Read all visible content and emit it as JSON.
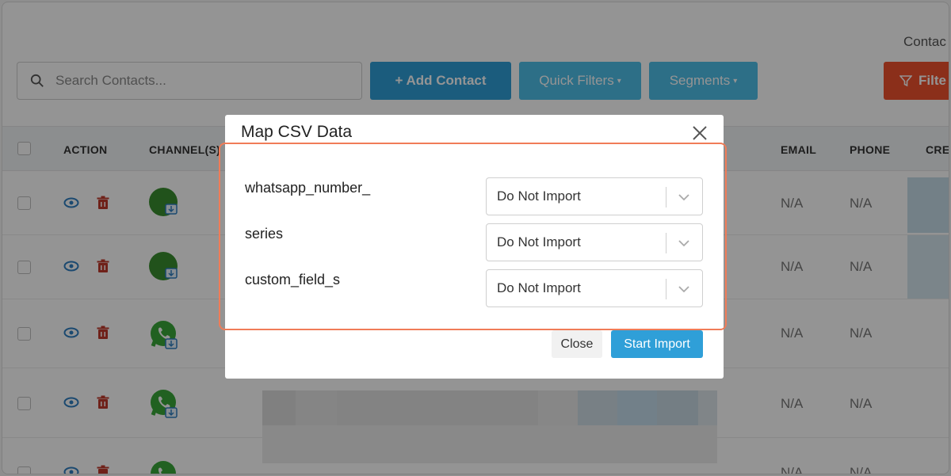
{
  "toolbar": {
    "contacts_title": "Contac",
    "search_placeholder": "Search Contacts...",
    "add_contact_label": "+ Add Contact",
    "quick_filters_label": "Quick Filters",
    "segments_label": "Segments",
    "filter_label": "Filte"
  },
  "table": {
    "headers": [
      "ACTION",
      "CHANNEL(S)",
      "EMAIL",
      "PHONE",
      "CREA"
    ],
    "rows": [
      {
        "email": "N/A",
        "phone": "N/A",
        "channel_icon": "channel-import-icon"
      },
      {
        "email": "N/A",
        "phone": "N/A",
        "channel_icon": "channel-import-icon"
      },
      {
        "email": "N/A",
        "phone": "N/A",
        "channel_icon": "whatsapp-icon"
      },
      {
        "email": "N/A",
        "phone": "N/A",
        "channel_icon": "whatsapp-icon"
      },
      {
        "email": "N/A",
        "phone": "N/A",
        "channel_icon": "whatsapp-icon"
      }
    ]
  },
  "modal": {
    "title": "Map CSV Data",
    "fields": [
      {
        "label": "whatsapp_number_",
        "value": "Do Not Import"
      },
      {
        "label": "series",
        "value": "Do Not Import"
      },
      {
        "label": "custom_field_s",
        "value": "Do Not Import"
      }
    ],
    "close_label": "Close",
    "start_import_label": "Start Import"
  },
  "colors": {
    "primary": "#2f9fd8",
    "secondary": "#4fbfe9",
    "danger": "#f0512e",
    "whatsapp": "#3aa83a",
    "highlight": "#f07c58"
  }
}
